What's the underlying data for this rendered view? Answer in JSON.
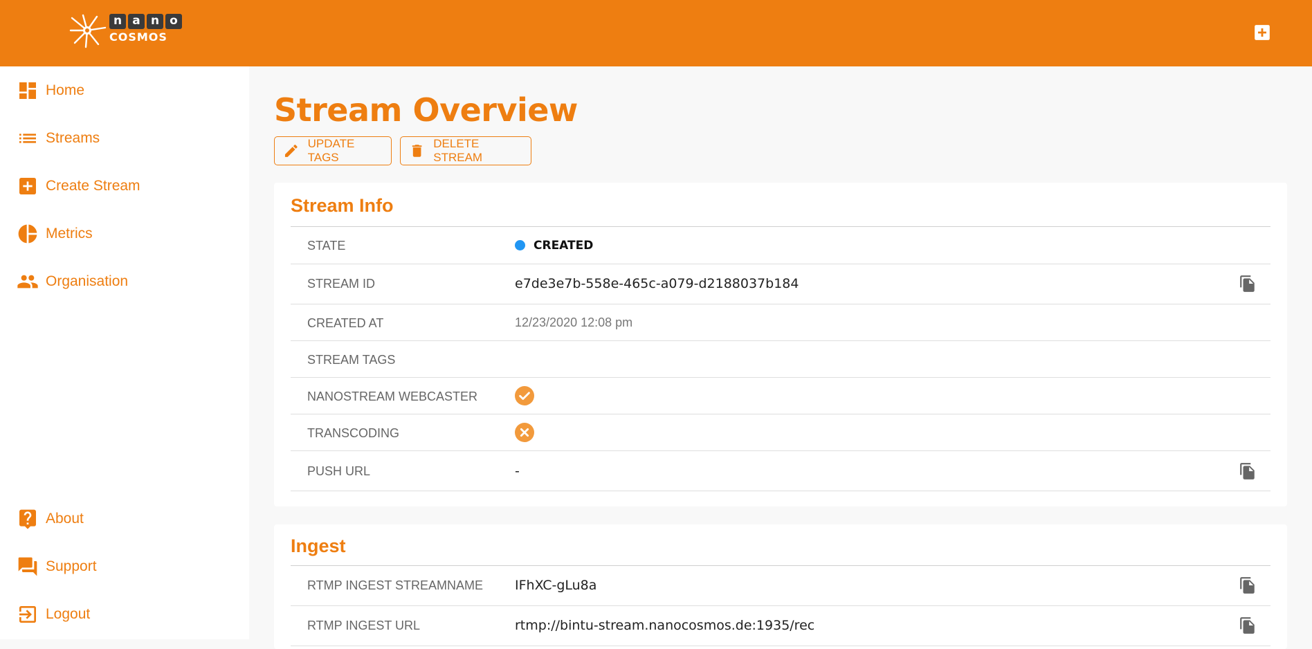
{
  "brand": {
    "logo_top": [
      "n",
      "a",
      "n",
      "o"
    ],
    "logo_bottom": "COSMOS",
    "color": "#ee7e11"
  },
  "sidebar": {
    "items": [
      {
        "label": "Home",
        "icon": "dashboard-icon"
      },
      {
        "label": "Streams",
        "icon": "list-icon"
      },
      {
        "label": "Create Stream",
        "icon": "add-box-icon"
      },
      {
        "label": "Metrics",
        "icon": "pie-chart-icon"
      },
      {
        "label": "Organisation",
        "icon": "people-icon"
      }
    ],
    "bottom_items": [
      {
        "label": "About",
        "icon": "help-icon"
      },
      {
        "label": "Support",
        "icon": "forum-icon"
      },
      {
        "label": "Logout",
        "icon": "exit-icon"
      }
    ]
  },
  "main": {
    "title": "Stream Overview",
    "buttons": {
      "update_tags": "UPDATE TAGS",
      "delete_stream": "DELETE STREAM"
    }
  },
  "stream_info": {
    "title": "Stream Info",
    "rows": [
      {
        "label": "STATE",
        "value": "CREATED",
        "status_color": "#2196f3"
      },
      {
        "label": "STREAM ID",
        "value": "e7de3e7b-558e-465c-a079-d2188037b184"
      },
      {
        "label": "CREATED AT",
        "value": "12/23/2020 12:08 pm"
      },
      {
        "label": "STREAM TAGS",
        "value": ""
      },
      {
        "label": "NANOSTREAM WEBCASTER",
        "value": "check-circle-icon"
      },
      {
        "label": "TRANSCODING",
        "value": "cancel-circle-icon"
      },
      {
        "label": "PUSH URL",
        "value": "-"
      }
    ]
  },
  "ingest": {
    "title": "Ingest",
    "rows": [
      {
        "label": "RTMP INGEST STREAMNAME",
        "value": "IFhXC-gLu8a"
      },
      {
        "label": "RTMP INGEST URL",
        "value": "rtmp://bintu-stream.nanocosmos.de:1935/rec"
      }
    ]
  }
}
